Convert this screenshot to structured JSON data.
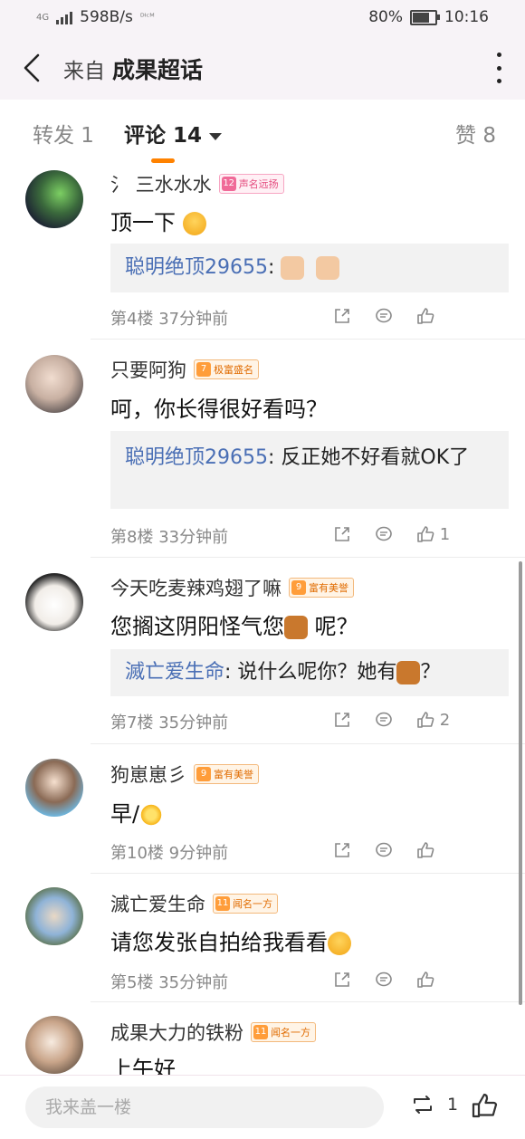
{
  "status": {
    "network": "4G",
    "speed": "598B/s",
    "battery": "80%",
    "battery_level": 0.8,
    "time": "10:16",
    "carrier_tag": "ᴰᴵᶜᴹ"
  },
  "header": {
    "prefix": "来自",
    "title": "成果超话"
  },
  "tabs": {
    "repost": "转发 1",
    "comment": "评论 14",
    "likes": "赞 8"
  },
  "comments": [
    {
      "user": "氵 三水水水",
      "badge_level": "12",
      "badge_text": "声名远扬",
      "text": "顶一下",
      "quote_user": "聪明绝顶29655",
      "quote_text": "",
      "floor": "第4楼",
      "time": "37分钟前",
      "likes": ""
    },
    {
      "user": "只要阿狗",
      "badge_level": "7",
      "badge_text": "极富盛名",
      "text": "呵，你长得很好看吗？",
      "quote_user": "聪明绝顶29655",
      "quote_text": "反正她不好看就OK了",
      "floor": "第8楼",
      "time": "33分钟前",
      "likes": "1"
    },
    {
      "user": "今天吃麦辣鸡翅了嘛",
      "badge_level": "9",
      "badge_text": "富有美誉",
      "text": "您搁这阴阳怪气您",
      "text_tail": "呢？",
      "quote_user": "滅亡爱生命",
      "quote_text": "说什么呢你？她有",
      "quote_tail": "？",
      "floor": "第7楼",
      "time": "35分钟前",
      "likes": "2"
    },
    {
      "user": "狗崽崽彡",
      "badge_level": "9",
      "badge_text": "富有美誉",
      "text": "早/",
      "floor": "第10楼",
      "time": "9分钟前",
      "likes": ""
    },
    {
      "user": "滅亡爱生命",
      "badge_level": "11",
      "badge_text": "闻名一方",
      "text": "请您发张自拍给我看看",
      "floor": "第5楼",
      "time": "35分钟前",
      "likes": ""
    },
    {
      "user": "成果大力的铁粉",
      "badge_level": "11",
      "badge_text": "闻名一方",
      "text": "上午好",
      "floor": "",
      "time": "",
      "likes": ""
    }
  ],
  "bottom": {
    "placeholder": "我来盖一楼",
    "repost_count": "1"
  },
  "colors": {
    "accent": "#ff8200",
    "link": "#4a6fb5",
    "meta": "#888888"
  }
}
